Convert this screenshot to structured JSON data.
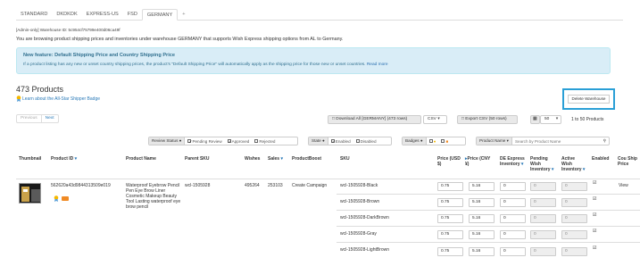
{
  "tabs": [
    "STANDARD",
    "DKDKDK",
    "EXPRESS-US",
    "FSD",
    "GERMANY",
    "+"
  ],
  "admin_note": "[Admin-only] Warehouse ID: 5c954cf75799e400d06ca49f",
  "browsing_note": "You are browsing product shipping prices and inventories under warehouse GERMANY that supports Wish Express shipping options from AL to Germany.",
  "info": {
    "title": "New feature: Default Shipping Price and Country Shipping Price",
    "text": "If a product listing has any new or unset country shipping prices, the product's \"Default Shipping Price\" will automatically apply as the shipping price for those new or unset countries.",
    "read_more": "Read more"
  },
  "products_count": "473 Products",
  "all_star_link": "Learn about the All-Star Shipper Badge",
  "delete_warehouse": "Delete Warehouse",
  "pager": {
    "previous": "Previous",
    "next": "Next"
  },
  "toolbar": {
    "download": "Download All [GERMANY] (473 rows)",
    "download_format": "CSV",
    "export": "Export CSV (50 rows)",
    "page_size": "50",
    "range": "1 to 50 Products"
  },
  "filters": {
    "review_status": "Review Status",
    "pending_review": "Pending Review",
    "approved": "Approved",
    "rejected": "Rejected",
    "state": "State",
    "enabled": "Enabled",
    "disabled": "Disabled",
    "badges": "Badges",
    "product_name": "Product Name",
    "search_placeholder": "Search by Product Name"
  },
  "columns": {
    "thumbnail": "Thumbnail",
    "product_id": "Product ID",
    "product_name": "Product Name",
    "parent_sku": "Parent SKU",
    "wishes": "Wishes",
    "sales": "Sales",
    "productboost": "ProductBoost",
    "sku": "SKU",
    "price_usd": "Price (USD $)",
    "price_cny": "Price (CNY ¥)",
    "de_express": "DE Express Inventory",
    "pending_wish": "Pending Wish Inventory",
    "active_wish": "Active Wish Inventory",
    "enabled": "Enabled",
    "country_price": "Cou Ship Price"
  },
  "product": {
    "id": "562620a43d9844313509e019",
    "name": "Waterproof Eyebrow Pencil Pen Eye Brow Liner Cosmetic Makeup Beauty Tool Lasting waterproof eye brow pencil",
    "parent_sku": "wcl-1505928",
    "wishes": "495264",
    "sales": "253103",
    "boost": "Create Campaign",
    "view": "View"
  },
  "variants": [
    {
      "sku": "wcl-1505928-Black",
      "usd": "0.75",
      "cny": "5.16",
      "de": "0",
      "pending": "0",
      "active": "0"
    },
    {
      "sku": "wcl-1505928-Brown",
      "usd": "0.75",
      "cny": "5.16",
      "de": "0",
      "pending": "0",
      "active": "0"
    },
    {
      "sku": "wcl-1505928-DarkBrown",
      "usd": "0.75",
      "cny": "5.16",
      "de": "0",
      "pending": "0",
      "active": "0"
    },
    {
      "sku": "wcl-1505928-Gray",
      "usd": "0.75",
      "cny": "5.16",
      "de": "0",
      "pending": "0",
      "active": "0"
    },
    {
      "sku": "wcl-1505928-LightBrown",
      "usd": "0.75",
      "cny": "5.16",
      "de": "0",
      "pending": "0",
      "active": "0"
    }
  ],
  "colors": {
    "accent": "#2a7ab8",
    "info_bg": "#d9edf7",
    "highlight": "#2a9fd6",
    "badge_yellow": "#f5b800",
    "badge_orange": "#f08a24"
  },
  "icons": [
    "badge-icon",
    "download-icon",
    "export-icon",
    "grid-icon",
    "info-circle-icon",
    "search-icon",
    "sort-caret-icon"
  ]
}
